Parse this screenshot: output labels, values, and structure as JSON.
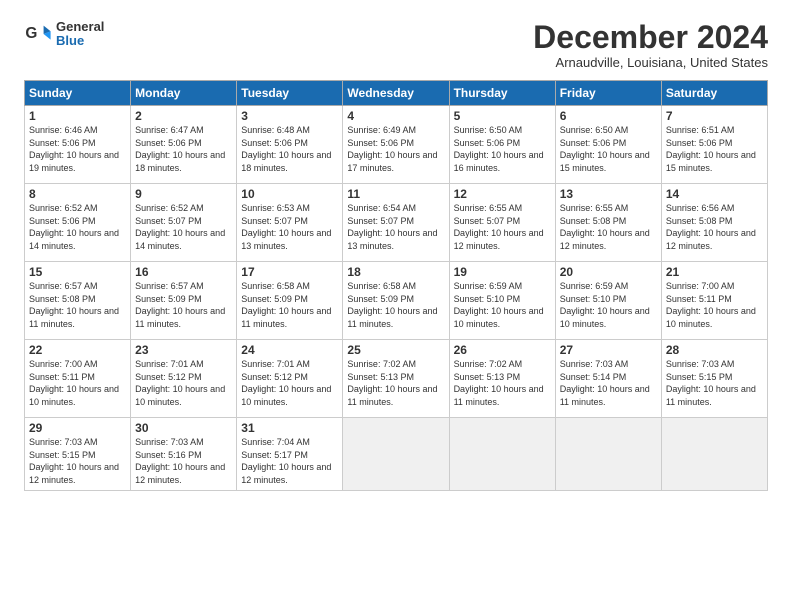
{
  "header": {
    "logo": {
      "general": "General",
      "blue": "Blue"
    },
    "title": "December 2024",
    "subtitle": "Arnaudville, Louisiana, United States"
  },
  "weekdays": [
    "Sunday",
    "Monday",
    "Tuesday",
    "Wednesday",
    "Thursday",
    "Friday",
    "Saturday"
  ],
  "weeks": [
    [
      {
        "day": "1",
        "sunrise": "6:46 AM",
        "sunset": "5:06 PM",
        "daylight": "10 hours and 19 minutes."
      },
      {
        "day": "2",
        "sunrise": "6:47 AM",
        "sunset": "5:06 PM",
        "daylight": "10 hours and 18 minutes."
      },
      {
        "day": "3",
        "sunrise": "6:48 AM",
        "sunset": "5:06 PM",
        "daylight": "10 hours and 18 minutes."
      },
      {
        "day": "4",
        "sunrise": "6:49 AM",
        "sunset": "5:06 PM",
        "daylight": "10 hours and 17 minutes."
      },
      {
        "day": "5",
        "sunrise": "6:50 AM",
        "sunset": "5:06 PM",
        "daylight": "10 hours and 16 minutes."
      },
      {
        "day": "6",
        "sunrise": "6:50 AM",
        "sunset": "5:06 PM",
        "daylight": "10 hours and 15 minutes."
      },
      {
        "day": "7",
        "sunrise": "6:51 AM",
        "sunset": "5:06 PM",
        "daylight": "10 hours and 15 minutes."
      }
    ],
    [
      {
        "day": "8",
        "sunrise": "6:52 AM",
        "sunset": "5:06 PM",
        "daylight": "10 hours and 14 minutes."
      },
      {
        "day": "9",
        "sunrise": "6:52 AM",
        "sunset": "5:07 PM",
        "daylight": "10 hours and 14 minutes."
      },
      {
        "day": "10",
        "sunrise": "6:53 AM",
        "sunset": "5:07 PM",
        "daylight": "10 hours and 13 minutes."
      },
      {
        "day": "11",
        "sunrise": "6:54 AM",
        "sunset": "5:07 PM",
        "daylight": "10 hours and 13 minutes."
      },
      {
        "day": "12",
        "sunrise": "6:55 AM",
        "sunset": "5:07 PM",
        "daylight": "10 hours and 12 minutes."
      },
      {
        "day": "13",
        "sunrise": "6:55 AM",
        "sunset": "5:08 PM",
        "daylight": "10 hours and 12 minutes."
      },
      {
        "day": "14",
        "sunrise": "6:56 AM",
        "sunset": "5:08 PM",
        "daylight": "10 hours and 12 minutes."
      }
    ],
    [
      {
        "day": "15",
        "sunrise": "6:57 AM",
        "sunset": "5:08 PM",
        "daylight": "10 hours and 11 minutes."
      },
      {
        "day": "16",
        "sunrise": "6:57 AM",
        "sunset": "5:09 PM",
        "daylight": "10 hours and 11 minutes."
      },
      {
        "day": "17",
        "sunrise": "6:58 AM",
        "sunset": "5:09 PM",
        "daylight": "10 hours and 11 minutes."
      },
      {
        "day": "18",
        "sunrise": "6:58 AM",
        "sunset": "5:09 PM",
        "daylight": "10 hours and 11 minutes."
      },
      {
        "day": "19",
        "sunrise": "6:59 AM",
        "sunset": "5:10 PM",
        "daylight": "10 hours and 10 minutes."
      },
      {
        "day": "20",
        "sunrise": "6:59 AM",
        "sunset": "5:10 PM",
        "daylight": "10 hours and 10 minutes."
      },
      {
        "day": "21",
        "sunrise": "7:00 AM",
        "sunset": "5:11 PM",
        "daylight": "10 hours and 10 minutes."
      }
    ],
    [
      {
        "day": "22",
        "sunrise": "7:00 AM",
        "sunset": "5:11 PM",
        "daylight": "10 hours and 10 minutes."
      },
      {
        "day": "23",
        "sunrise": "7:01 AM",
        "sunset": "5:12 PM",
        "daylight": "10 hours and 10 minutes."
      },
      {
        "day": "24",
        "sunrise": "7:01 AM",
        "sunset": "5:12 PM",
        "daylight": "10 hours and 10 minutes."
      },
      {
        "day": "25",
        "sunrise": "7:02 AM",
        "sunset": "5:13 PM",
        "daylight": "10 hours and 11 minutes."
      },
      {
        "day": "26",
        "sunrise": "7:02 AM",
        "sunset": "5:13 PM",
        "daylight": "10 hours and 11 minutes."
      },
      {
        "day": "27",
        "sunrise": "7:03 AM",
        "sunset": "5:14 PM",
        "daylight": "10 hours and 11 minutes."
      },
      {
        "day": "28",
        "sunrise": "7:03 AM",
        "sunset": "5:15 PM",
        "daylight": "10 hours and 11 minutes."
      }
    ],
    [
      {
        "day": "29",
        "sunrise": "7:03 AM",
        "sunset": "5:15 PM",
        "daylight": "10 hours and 12 minutes."
      },
      {
        "day": "30",
        "sunrise": "7:03 AM",
        "sunset": "5:16 PM",
        "daylight": "10 hours and 12 minutes."
      },
      {
        "day": "31",
        "sunrise": "7:04 AM",
        "sunset": "5:17 PM",
        "daylight": "10 hours and 12 minutes."
      },
      null,
      null,
      null,
      null
    ]
  ]
}
